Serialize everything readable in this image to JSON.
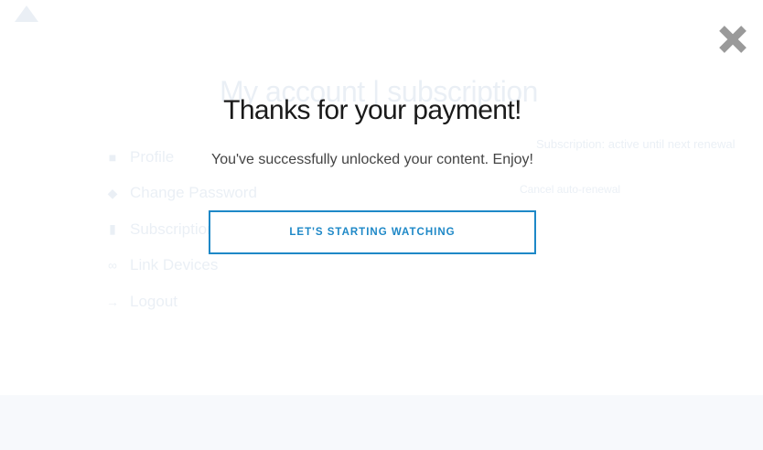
{
  "background": {
    "page_title": "My account | subscription",
    "menu": [
      {
        "icon": "user-icon",
        "label": "Profile"
      },
      {
        "icon": "key-icon",
        "label": "Change Password"
      },
      {
        "icon": "card-icon",
        "label": "Subscriptions"
      },
      {
        "icon": "link-icon",
        "label": "Link Devices"
      },
      {
        "icon": "logout-icon",
        "label": "Logout"
      }
    ],
    "right_text_1": "Subscription: active until next renewal",
    "right_text_2": "Cancel auto-renewal"
  },
  "modal": {
    "title": "Thanks for your payment!",
    "message": "You've successfully unlocked your content. Enjoy!",
    "cta_label": "LET'S STARTING WATCHING",
    "close_icon": "close-icon",
    "accent_color": "#1e88c7",
    "close_color": "#9a9a9a"
  }
}
